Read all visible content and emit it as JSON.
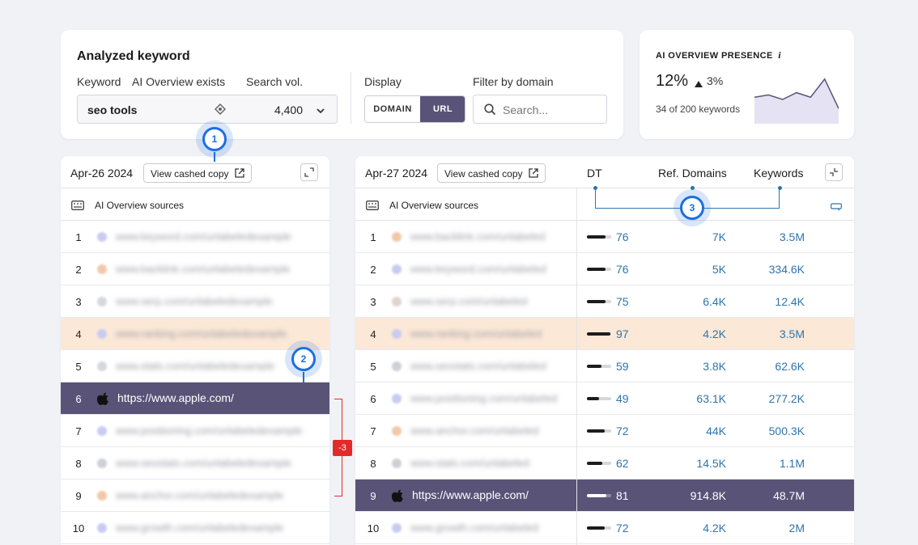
{
  "analyzed": {
    "title": "Analyzed keyword",
    "col_keyword": "Keyword",
    "col_ai_overview": "AI Overview exists",
    "col_search_vol": "Search vol.",
    "keyword_value": "seo tools",
    "search_vol_value": "4,400",
    "display_label": "Display",
    "display_options": [
      "DOMAIN",
      "URL"
    ],
    "display_selected": "URL",
    "filter_label": "Filter by domain",
    "filter_placeholder": "Search..."
  },
  "presence": {
    "title": "AI OVERVIEW PRESENCE",
    "info": "i",
    "percent": "12%",
    "delta": "3%",
    "sub": "34 of 200 keywords",
    "spark": [
      0.55,
      0.6,
      0.5,
      0.65,
      0.55,
      0.95,
      0.3
    ]
  },
  "markers": [
    "1",
    "2",
    "3"
  ],
  "left": {
    "date": "Apr-26 2024",
    "view_copy": "View cashed copy",
    "sources_label": "AI Overview sources",
    "rows": [
      {
        "n": "1",
        "url": "www.keyword.com/unlabeledexample",
        "fav": "#c9cbf2"
      },
      {
        "n": "2",
        "url": "www.backlink.com/unlabeledexample",
        "fav": "#f1c8a8"
      },
      {
        "n": "3",
        "url": "www.serp.com/unlabeledexample",
        "fav": "#d6d7de"
      },
      {
        "n": "4",
        "url": "www.ranking.com/unlabeledexample",
        "fav": "#c9cbf2"
      },
      {
        "n": "5",
        "url": "www.stats.com/unlabeledexample",
        "fav": "#d6d7de"
      },
      {
        "n": "6",
        "url": "https://www.apple.com/",
        "fav": "apple"
      },
      {
        "n": "7",
        "url": "www.positioning.com/unlabeledexample",
        "fav": "#c9cbf2"
      },
      {
        "n": "8",
        "url": "www.seostats.com/unlabeledexample",
        "fav": "#cfd0d6"
      },
      {
        "n": "9",
        "url": "www.anchor.com/unlabeledexample",
        "fav": "#f1c8a8"
      },
      {
        "n": "10",
        "url": "www.growth.com/unlabeledexample",
        "fav": "#c9cbf2"
      }
    ]
  },
  "change_badge": "-3",
  "right": {
    "date": "Apr-27 2024",
    "view_copy": "View cashed copy",
    "col_dt": "DT",
    "col_ref": "Ref. Domains",
    "col_kw": "Keywords",
    "sources_label": "AI Overview sources",
    "rows": [
      {
        "n": "1",
        "url": "www.backlink.com/unlabeled",
        "fav": "#f1c8a8",
        "dt": "76",
        "dtv": 0.76,
        "ref": "7K",
        "kw": "3.5M"
      },
      {
        "n": "2",
        "url": "www.keyword.com/unlabeled",
        "fav": "#c9cbf2",
        "dt": "76",
        "dtv": 0.76,
        "ref": "5K",
        "kw": "334.6K"
      },
      {
        "n": "3",
        "url": "www.serp.com/unlabeled",
        "fav": "#e2d3d0",
        "dt": "75",
        "dtv": 0.75,
        "ref": "6.4K",
        "kw": "12.4K"
      },
      {
        "n": "4",
        "url": "www.ranking.com/unlabeled",
        "fav": "#c9cbf2",
        "dt": "97",
        "dtv": 0.97,
        "ref": "4.2K",
        "kw": "3.5M"
      },
      {
        "n": "5",
        "url": "www.seostats.com/unlabeled",
        "fav": "#cfd0d6",
        "dt": "59",
        "dtv": 0.59,
        "ref": "3.8K",
        "kw": "62.6K"
      },
      {
        "n": "6",
        "url": "www.positioning.com/unlabeled",
        "fav": "#c9cbf2",
        "dt": "49",
        "dtv": 0.49,
        "ref": "63.1K",
        "kw": "277.2K"
      },
      {
        "n": "7",
        "url": "www.anchor.com/unlabeled",
        "fav": "#f1c8a8",
        "dt": "72",
        "dtv": 0.72,
        "ref": "44K",
        "kw": "500.3K"
      },
      {
        "n": "8",
        "url": "www.stats.com/unlabeled",
        "fav": "#cfd0d6",
        "dt": "62",
        "dtv": 0.62,
        "ref": "14.5K",
        "kw": "1.1M"
      },
      {
        "n": "9",
        "url": "https://www.apple.com/",
        "fav": "apple",
        "dt": "81",
        "dtv": 0.81,
        "ref": "914.8K",
        "kw": "48.7M"
      },
      {
        "n": "10",
        "url": "www.growth.com/unlabeled",
        "fav": "#c9cbf2",
        "dt": "72",
        "dtv": 0.72,
        "ref": "4.2K",
        "kw": "2M"
      }
    ]
  }
}
